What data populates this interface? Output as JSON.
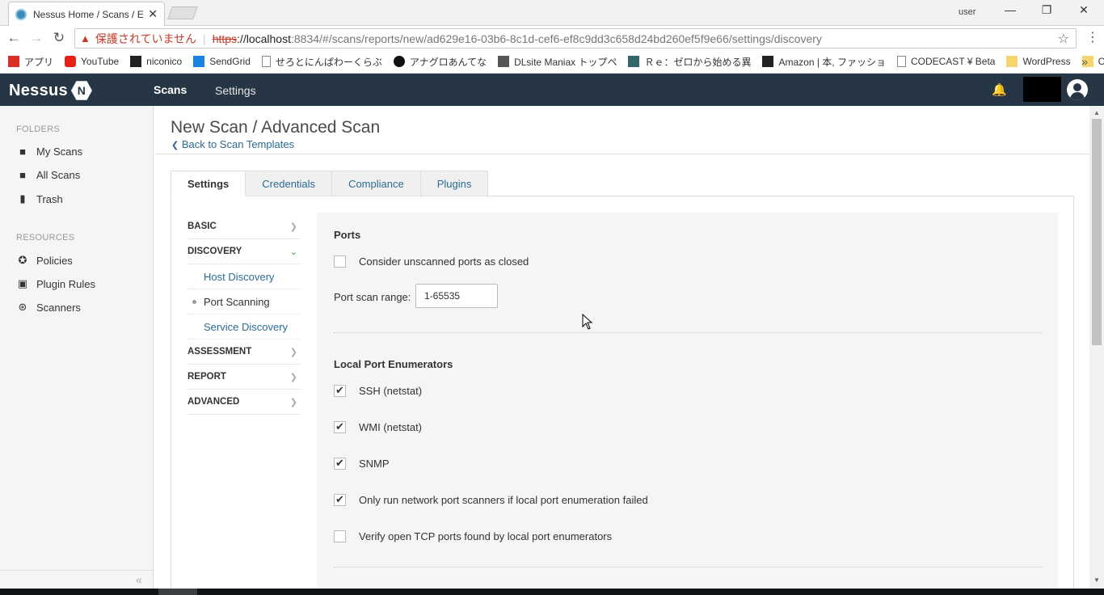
{
  "browser": {
    "tab_title": "Nessus Home / Scans / E",
    "user_label": "user",
    "window_controls": {
      "minimize": "—",
      "restore": "❐",
      "close": "✕"
    },
    "address": {
      "insecure_label": "保護されていません",
      "scheme": "https",
      "host": "://localhost",
      "path": ":8834/#/scans/reports/new/ad629e16-03b6-8c1d-cef6-ef8c9dd3c658d24bd260ef5f9e66/settings/discovery"
    },
    "bookmarks": [
      {
        "label": "アプリ",
        "icon": "apps-grid-icon",
        "color": "#d93025"
      },
      {
        "label": "YouTube",
        "icon": "youtube-icon",
        "color": "#e62117"
      },
      {
        "label": "niconico",
        "icon": "niconico-icon",
        "color": "#222222"
      },
      {
        "label": "SendGrid",
        "icon": "sendgrid-icon",
        "color": "#1a82e2"
      },
      {
        "label": "せろとにんぱわーくらぶ",
        "icon": "page-icon",
        "color": "#888888"
      },
      {
        "label": "アナグロあんてな",
        "icon": "circle-icon",
        "color": "#111111"
      },
      {
        "label": "DLsite Maniax トップペ",
        "icon": "dlsite-icon",
        "color": "#555555"
      },
      {
        "label": "Ｒｅ：ゼロから始める異",
        "icon": "re-zero-icon",
        "color": "#336666"
      },
      {
        "label": "Amazon | 本, ファッショ",
        "icon": "amazon-icon",
        "color": "#222222"
      },
      {
        "label": "CODECAST ¥ Beta",
        "icon": "page-icon",
        "color": "#888888"
      },
      {
        "label": "WordPress",
        "icon": "folder-icon",
        "color": "#f5d76e"
      },
      {
        "label": "CentOS",
        "icon": "folder-icon",
        "color": "#f5d76e"
      }
    ]
  },
  "header": {
    "logo": "Nessus",
    "logo_badge": "N",
    "nav": {
      "scans": "Scans",
      "settings": "Settings"
    }
  },
  "sidebar": {
    "folders_label": "FOLDERS",
    "folders": [
      {
        "label": "My Scans",
        "icon": "folder-icon"
      },
      {
        "label": "All Scans",
        "icon": "folder-icon"
      },
      {
        "label": "Trash",
        "icon": "trash-icon"
      }
    ],
    "resources_label": "RESOURCES",
    "resources": [
      {
        "label": "Policies",
        "icon": "policy-badge-icon"
      },
      {
        "label": "Plugin Rules",
        "icon": "plugin-rules-icon"
      },
      {
        "label": "Scanners",
        "icon": "scanner-antenna-icon"
      }
    ]
  },
  "main": {
    "title": "New Scan / Advanced Scan",
    "back_link": "Back to Scan Templates",
    "tabs": [
      {
        "label": "Settings",
        "active": true
      },
      {
        "label": "Credentials",
        "active": false
      },
      {
        "label": "Compliance",
        "active": false
      },
      {
        "label": "Plugins",
        "active": false
      }
    ],
    "settings_nav": {
      "basic": "BASIC",
      "discovery": "DISCOVERY",
      "discovery_sub": [
        "Host Discovery",
        "Port Scanning",
        "Service Discovery"
      ],
      "assessment": "ASSESSMENT",
      "report": "REPORT",
      "advanced": "ADVANCED"
    },
    "ports": {
      "heading": "Ports",
      "consider_unscanned": {
        "label": "Consider unscanned ports as closed",
        "checked": false
      },
      "port_scan_range_label": "Port scan range:",
      "port_scan_range_value": "1-65535"
    },
    "local_enumerators": {
      "heading": "Local Port Enumerators",
      "options": [
        {
          "label": "SSH (netstat)",
          "checked": true
        },
        {
          "label": "WMI (netstat)",
          "checked": true
        },
        {
          "label": "SNMP",
          "checked": true
        },
        {
          "label": "Only run network port scanners if local port enumeration failed",
          "checked": true
        },
        {
          "label": "Verify open TCP ports found by local port enumerators",
          "checked": false
        }
      ]
    }
  }
}
